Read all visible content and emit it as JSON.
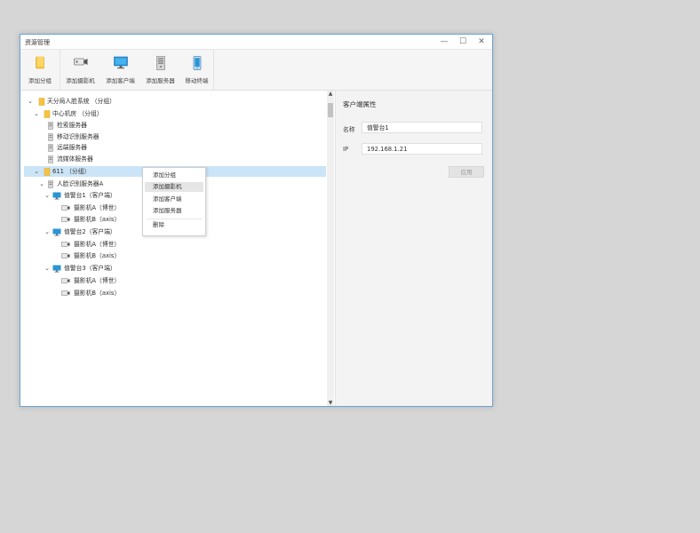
{
  "window": {
    "title": "资源管理"
  },
  "title_buttons": {
    "minimize": "—",
    "maximize": "☐",
    "close": "✕"
  },
  "toolbar": [
    {
      "label": "添加分组",
      "icon": "folder-icon"
    },
    {
      "label": "添加摄影机",
      "icon": "camera-icon"
    },
    {
      "label": "添加客户端",
      "icon": "monitor-icon"
    },
    {
      "label": "添加服务器",
      "icon": "server-icon"
    },
    {
      "label": "移动终端",
      "icon": "mobile-icon"
    }
  ],
  "tree": [
    {
      "label": "天分局人脸系统 （分组）",
      "icon": "folder-icon",
      "expanded": true
    },
    {
      "label": "中心机房 （分组）",
      "icon": "folder-icon",
      "expanded": true
    },
    {
      "label": "检索服务器",
      "icon": "server-icon"
    },
    {
      "label": "移动识别服务器",
      "icon": "server-icon"
    },
    {
      "label": "远端服务器",
      "icon": "server-icon"
    },
    {
      "label": "流媒体服务器",
      "icon": "server-icon"
    },
    {
      "label": "611 （分组）",
      "icon": "folder-icon",
      "expanded": true,
      "selected": true
    },
    {
      "label": "人脸识别服务器A",
      "icon": "server-icon",
      "expanded": true
    },
    {
      "label": "值警台1（客户端）",
      "icon": "monitor-icon",
      "expanded": true
    },
    {
      "label": "摄影机A（博世）",
      "icon": "camera-icon"
    },
    {
      "label": "摄影机B（axis）",
      "icon": "camera-icon"
    },
    {
      "label": "值警台2（客户端）",
      "icon": "monitor-icon",
      "expanded": true
    },
    {
      "label": "摄影机A（博世）",
      "icon": "camera-icon"
    },
    {
      "label": "摄影机B（axis）",
      "icon": "camera-icon"
    },
    {
      "label": "值警台3（客户端）",
      "icon": "monitor-icon",
      "expanded": true
    },
    {
      "label": "摄影机A（博世）",
      "icon": "camera-icon"
    },
    {
      "label": "摄影机B（axis）",
      "icon": "camera-icon"
    }
  ],
  "context_menu": [
    "添加分组",
    "添加摄影机",
    "添加客户端",
    "添加服务器",
    "删除"
  ],
  "context_menu_highlighted": "添加摄影机",
  "properties": {
    "title": "客户端属性",
    "name_label": "名称",
    "name_value": "值警台1",
    "ip_label": "IP",
    "ip_value": "192.168.1.21",
    "apply_label": "应用"
  },
  "scrollbar": {
    "up": "▲",
    "down": "▼"
  },
  "colors": {
    "selection": "#cce4f7",
    "folder": "#f5c342",
    "monitor": "#2b95d6",
    "window_border": "#6aa5d6"
  }
}
